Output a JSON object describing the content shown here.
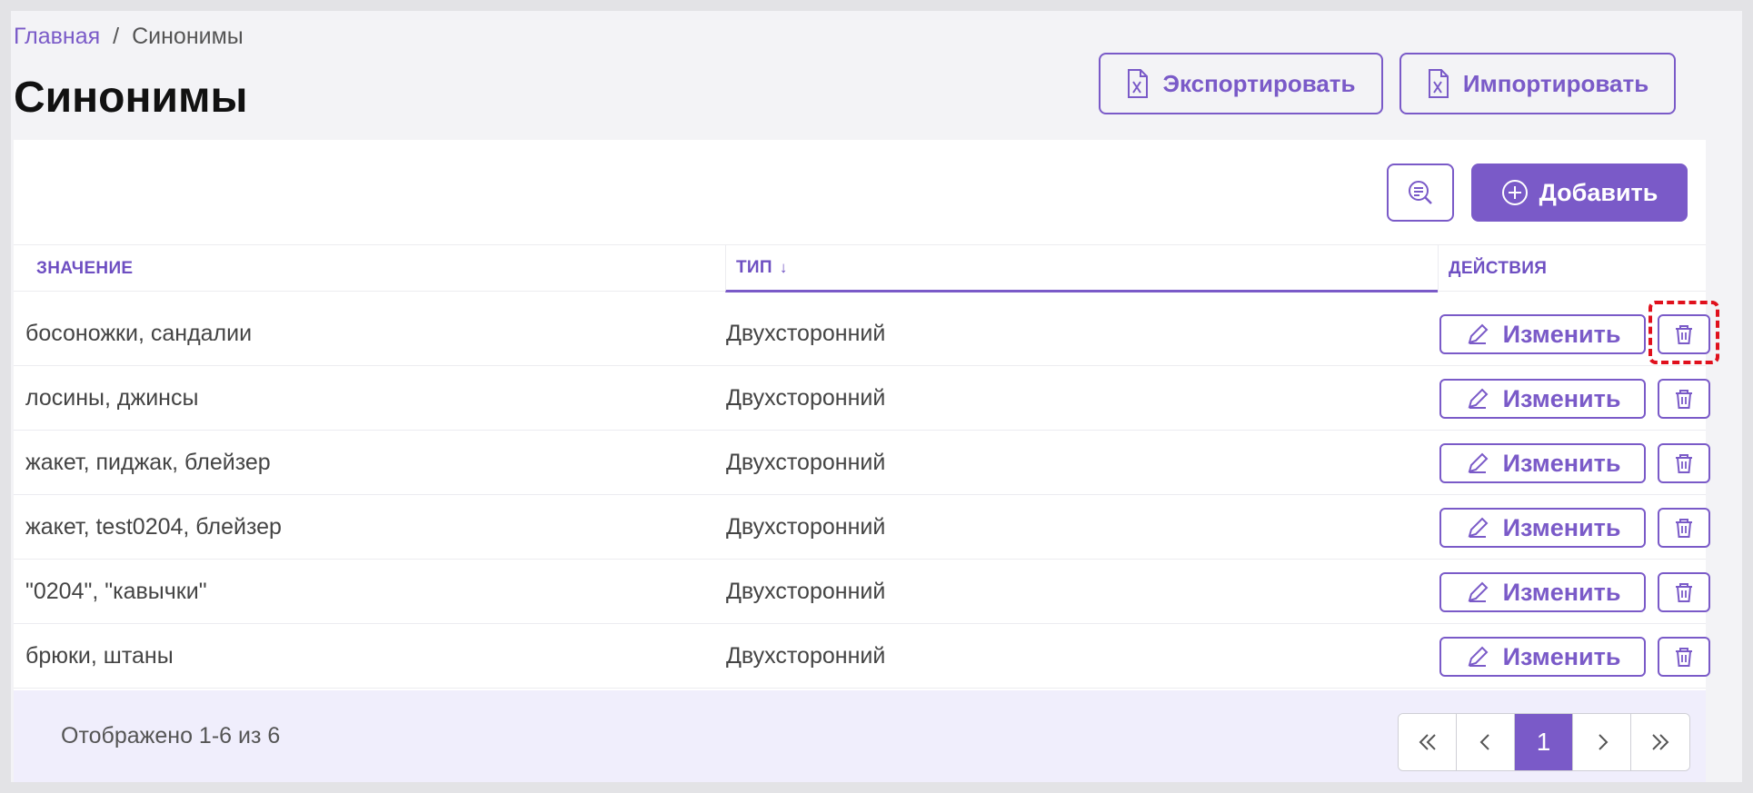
{
  "breadcrumb": {
    "home": "Главная",
    "separator": "/",
    "current": "Синонимы"
  },
  "page_title": "Синонимы",
  "header_actions": {
    "export_label": "Экспортировать",
    "import_label": "Импортировать"
  },
  "toolbar": {
    "add_label": "Добавить"
  },
  "table": {
    "columns": {
      "value": "ЗНАЧЕНИЕ",
      "type": "ТИП",
      "type_sort": "↓",
      "actions": "ДЕЙСТВИЯ"
    },
    "edit_label": "Изменить",
    "rows": [
      {
        "value": "босоножки, сандалии",
        "type": "Двухсторонний"
      },
      {
        "value": "лосины, джинсы",
        "type": "Двухсторонний"
      },
      {
        "value": "жакет, пиджак, блейзер",
        "type": "Двухсторонний"
      },
      {
        "value": "жакет, test0204, блейзер",
        "type": "Двухсторонний"
      },
      {
        "value": "\"0204\", \"кавычки\"",
        "type": "Двухсторонний"
      },
      {
        "value": "брюки, штаны",
        "type": "Двухсторонний"
      }
    ]
  },
  "footer": {
    "summary": "Отображено 1-6 из 6"
  },
  "pagination": {
    "first": "«",
    "prev": "‹",
    "current": "1",
    "next": "›",
    "last": "»"
  },
  "colors": {
    "accent": "#7a5ac8",
    "highlight": "#e0101c"
  },
  "icons": [
    "excel-file-icon",
    "search-filter-icon",
    "plus-circle-icon",
    "pencil-icon",
    "trash-icon"
  ]
}
